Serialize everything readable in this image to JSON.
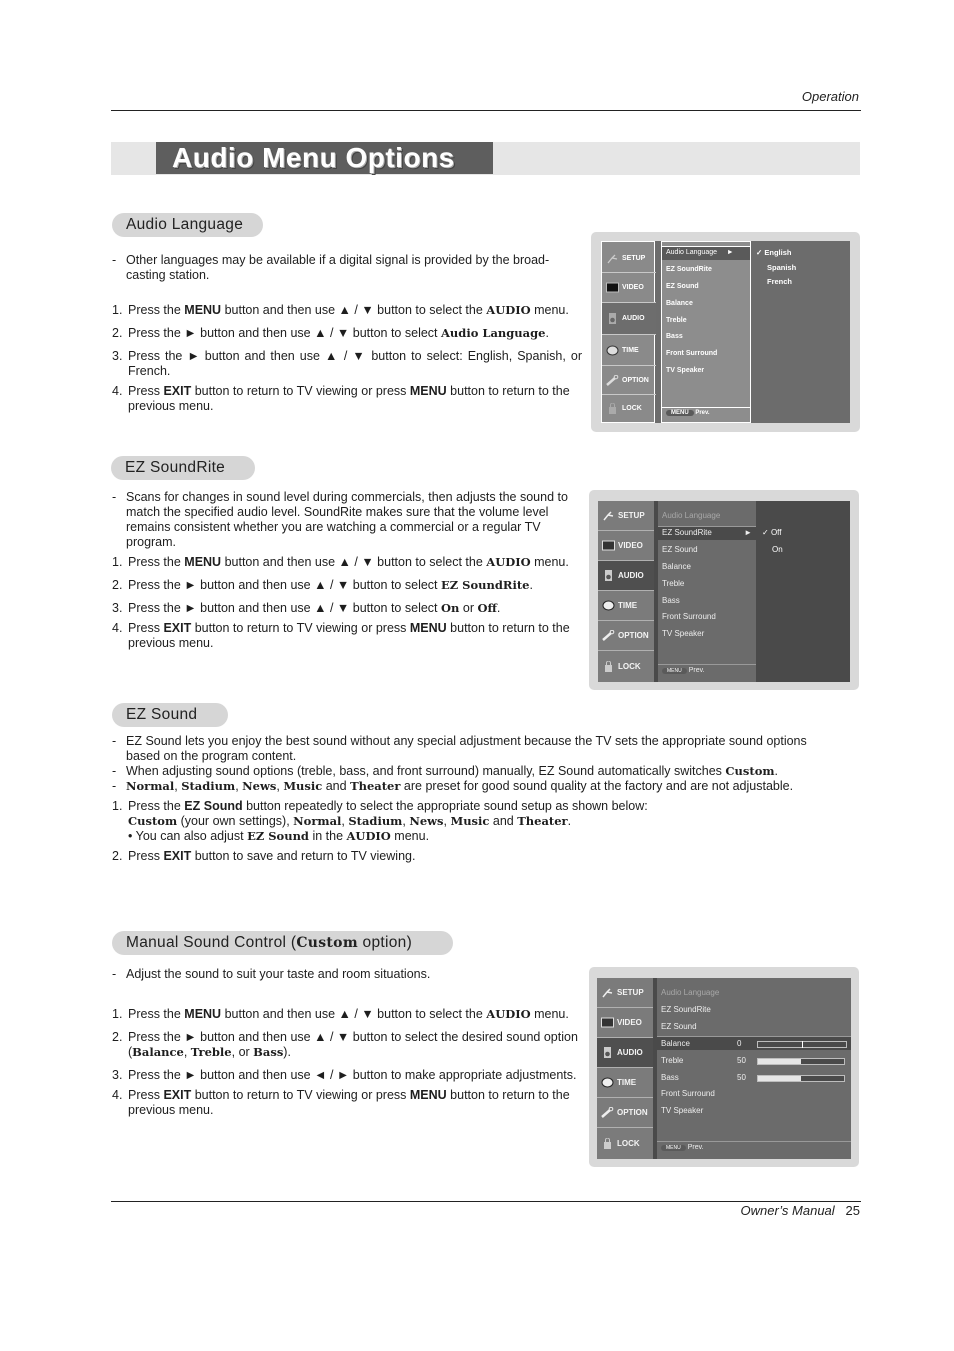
{
  "header": {
    "section": "Operation"
  },
  "title": "Audio Menu Options",
  "footer": {
    "label": "Owner’s Manual",
    "page": "25"
  },
  "sections": {
    "audio_language": {
      "heading": "Audio Language",
      "notes": [
        "Other languages may be available if a digital signal is provided by the broad-casting station."
      ],
      "steps": [
        {
          "n": "1.",
          "parts": [
            "Press the ",
            "MENU",
            " button and then use ▲ / ▼  button to select the ",
            "AUDIO",
            " menu."
          ]
        },
        {
          "n": "2.",
          "parts": [
            "Press the ► button and then use ▲ / ▼ button to select ",
            "Audio Language",
            "."
          ]
        },
        {
          "n": "3.",
          "parts": [
            "Press the ►  button and then use ▲ / ▼ button to select: English, Spanish, or French."
          ]
        },
        {
          "n": "4.",
          "parts": [
            "Press ",
            "EXIT",
            " button to return to TV viewing or press ",
            "MENU",
            " button to return to the previous menu."
          ]
        }
      ]
    },
    "ez_soundrite": {
      "heading": "EZ SoundRite",
      "notes": [
        "Scans for changes in sound level during commercials, then adjusts the sound to match the specified audio level. SoundRite makes sure that the volume level remains consistent whether you are watching a commercial or a regular TV program."
      ],
      "steps": [
        {
          "n": "1.",
          "parts": [
            "Press the ",
            "MENU",
            " button and then use ▲ / ▼  button to select the ",
            "AUDIO",
            " menu."
          ]
        },
        {
          "n": "2.",
          "parts": [
            "Press the ►  button and then use ▲ / ▼ button to select ",
            "EZ SoundRite",
            "."
          ]
        },
        {
          "n": "3.",
          "parts": [
            "Press the ►  button and then use ▲ / ▼ button to select ",
            "On",
            " or ",
            "Off",
            "."
          ]
        },
        {
          "n": "4.",
          "parts": [
            "Press ",
            "EXIT",
            " button to return to TV viewing or press ",
            "MENU",
            " button to return to the previous menu."
          ]
        }
      ]
    },
    "ez_sound": {
      "heading": "EZ Sound",
      "notes": [
        "EZ Sound lets you enjoy the best sound without any special adjustment because the TV sets the appropriate sound options based on the program content.",
        [
          "When adjusting sound options (treble, bass, and front surround) manually, EZ Sound automatically switches ",
          "Custom",
          "."
        ],
        [
          "",
          "Normal",
          ", ",
          "Stadium",
          ", ",
          "News",
          ", ",
          "Music",
          " and ",
          "Theater",
          " are preset for good sound quality at the factory and are not adjustable."
        ]
      ],
      "step1": {
        "n": "1.",
        "line1": [
          "Press the ",
          "EZ Sound",
          " button repeatedly to select the appropriate sound setup as shown below:"
        ],
        "line2": [
          "",
          "Custom",
          " (your own settings), ",
          "Normal",
          ", ",
          "Stadium",
          ", ",
          "News",
          ", ",
          "Music",
          " and ",
          "Theater",
          "."
        ],
        "line3": [
          "• You can also adjust ",
          "EZ Sound",
          " in the ",
          "AUDIO",
          " menu."
        ]
      },
      "step2": {
        "n": "2.",
        "parts": [
          "Press ",
          "EXIT",
          " button to save and return to TV viewing."
        ]
      }
    },
    "manual_sound": {
      "heading_pre": "Manual Sound Control (",
      "heading_bold": "Custom",
      "heading_post": " option)",
      "notes": [
        "Adjust the sound to suit your taste and room situations."
      ],
      "steps": [
        {
          "n": "1.",
          "parts": [
            "Press the ",
            "MENU",
            " button and then use ▲ / ▼  button to select the ",
            "AUDIO",
            " menu."
          ]
        },
        {
          "n": "2.",
          "parts": [
            "Press the ► button and then use ▲ / ▼ button to select the desired sound option (",
            "Balance",
            ", ",
            "Treble",
            ", or ",
            "Bass",
            ")."
          ]
        },
        {
          "n": "3.",
          "parts": [
            "Press the ►  button and then use ◄ / ► button to make appropriate adjustments."
          ]
        },
        {
          "n": "4.",
          "parts": [
            "Press ",
            "EXIT",
            " button to return to TV viewing or press ",
            "MENU",
            " button to return to the previous menu."
          ]
        }
      ]
    }
  },
  "tv_menu": {
    "sidebar": [
      {
        "label": "SETUP",
        "icon": "satellite-icon"
      },
      {
        "label": "VIDEO",
        "icon": "screen-icon"
      },
      {
        "label": "AUDIO",
        "icon": "speaker-icon"
      },
      {
        "label": "TIME",
        "icon": "clock-icon"
      },
      {
        "label": "OPTION",
        "icon": "wrench-icon"
      },
      {
        "label": "LOCK",
        "icon": "lock-icon"
      }
    ],
    "items": [
      "Audio Language",
      "EZ SoundRite",
      "EZ Sound",
      "Balance",
      "Treble",
      "Bass",
      "Front Surround",
      "TV Speaker"
    ],
    "menu_button": "MENU",
    "prev_label": "Prev.",
    "submenu_arrow": "►",
    "check": "✓",
    "screen1": {
      "active_sidebar": "AUDIO",
      "selected_item": "Audio Language",
      "options": [
        "English",
        "Spanish",
        "French"
      ],
      "checked": "English"
    },
    "screen2": {
      "active_sidebar": "AUDIO",
      "selected_item": "EZ SoundRite",
      "options": [
        "Off",
        "On"
      ],
      "checked": "Off"
    },
    "screen3": {
      "active_sidebar": "AUDIO",
      "selected_item": "Balance",
      "sliders": [
        {
          "label": "Balance",
          "value": "0",
          "fraction": 0.5
        },
        {
          "label": "Treble",
          "value": "50",
          "fraction": 0.5
        },
        {
          "label": "Bass",
          "value": "50",
          "fraction": 0.5
        }
      ]
    }
  }
}
